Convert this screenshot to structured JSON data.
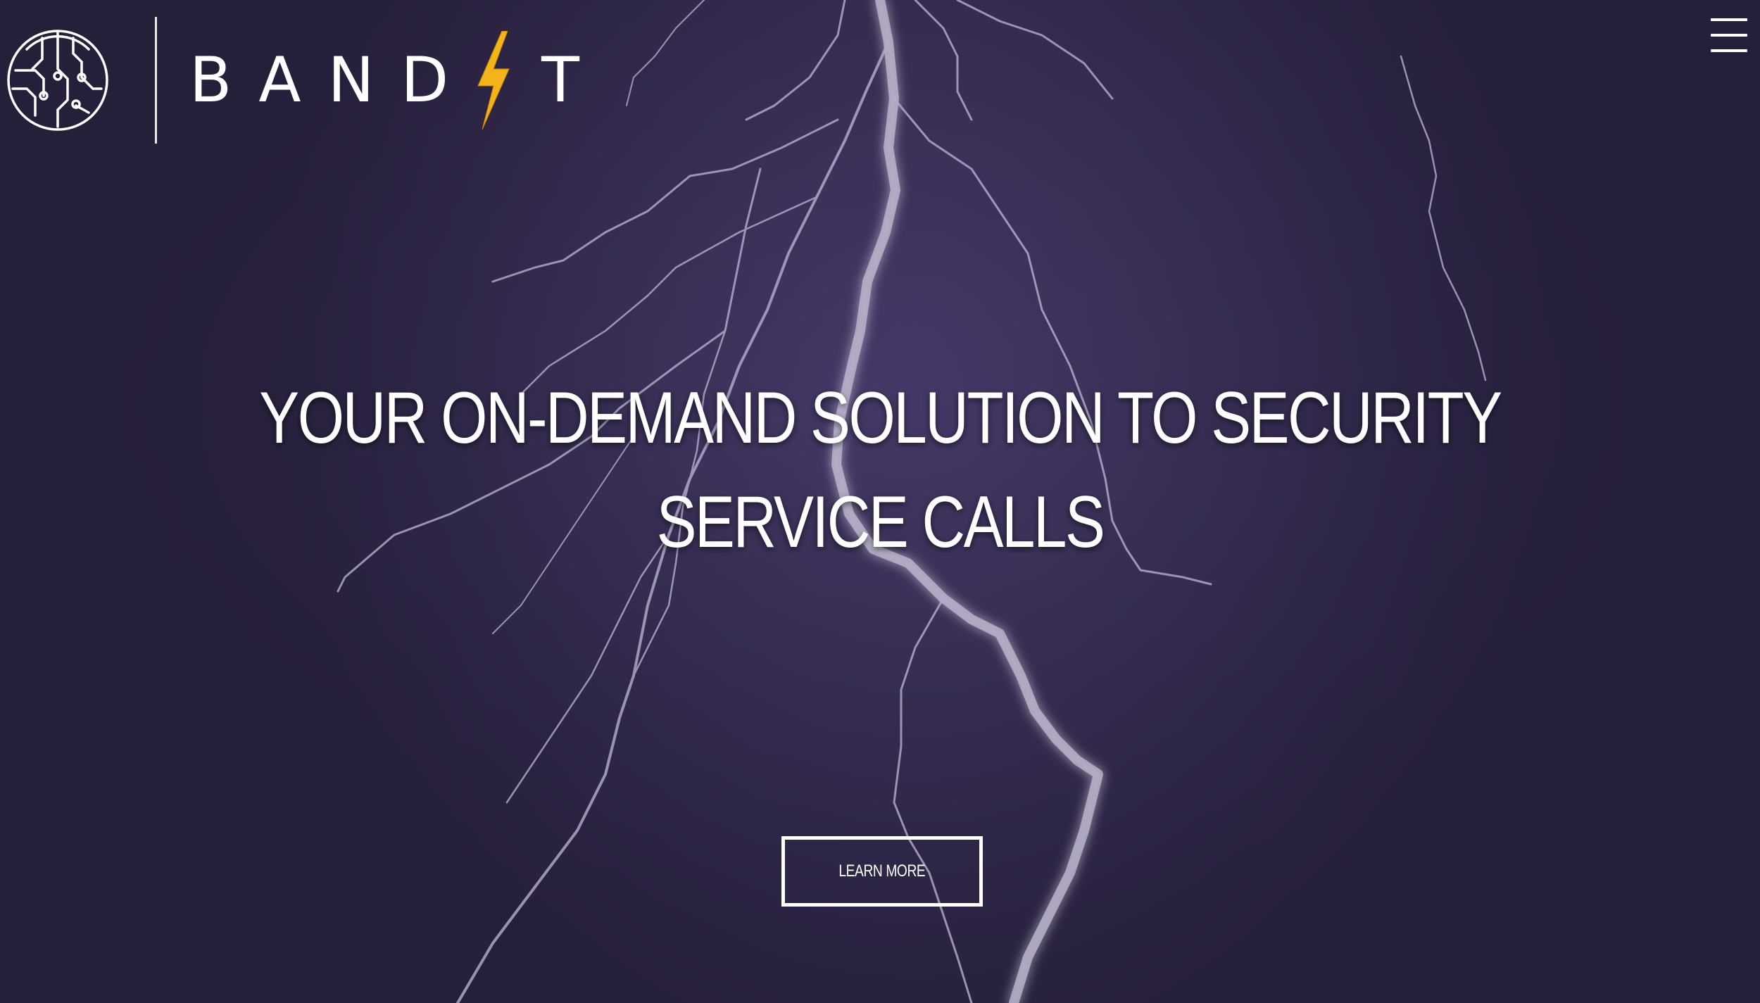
{
  "header": {
    "brand_name": "BAND",
    "brand_last_letter": "T",
    "brand_bolt_icon": "lightning-bolt-icon",
    "emblem_icon": "circuit-emblem-icon",
    "menu_icon": "hamburger-menu-icon"
  },
  "hero": {
    "headline_line1": "YOUR ON-DEMAND SOLUTION TO SECURITY",
    "headline_line2": "SERVICE CALLS",
    "cta_label": "LEARN MORE",
    "background": "lightning-storm-image"
  },
  "colors": {
    "background": "#3d3259",
    "text": "#ffffff",
    "bolt": "#f2b418"
  }
}
